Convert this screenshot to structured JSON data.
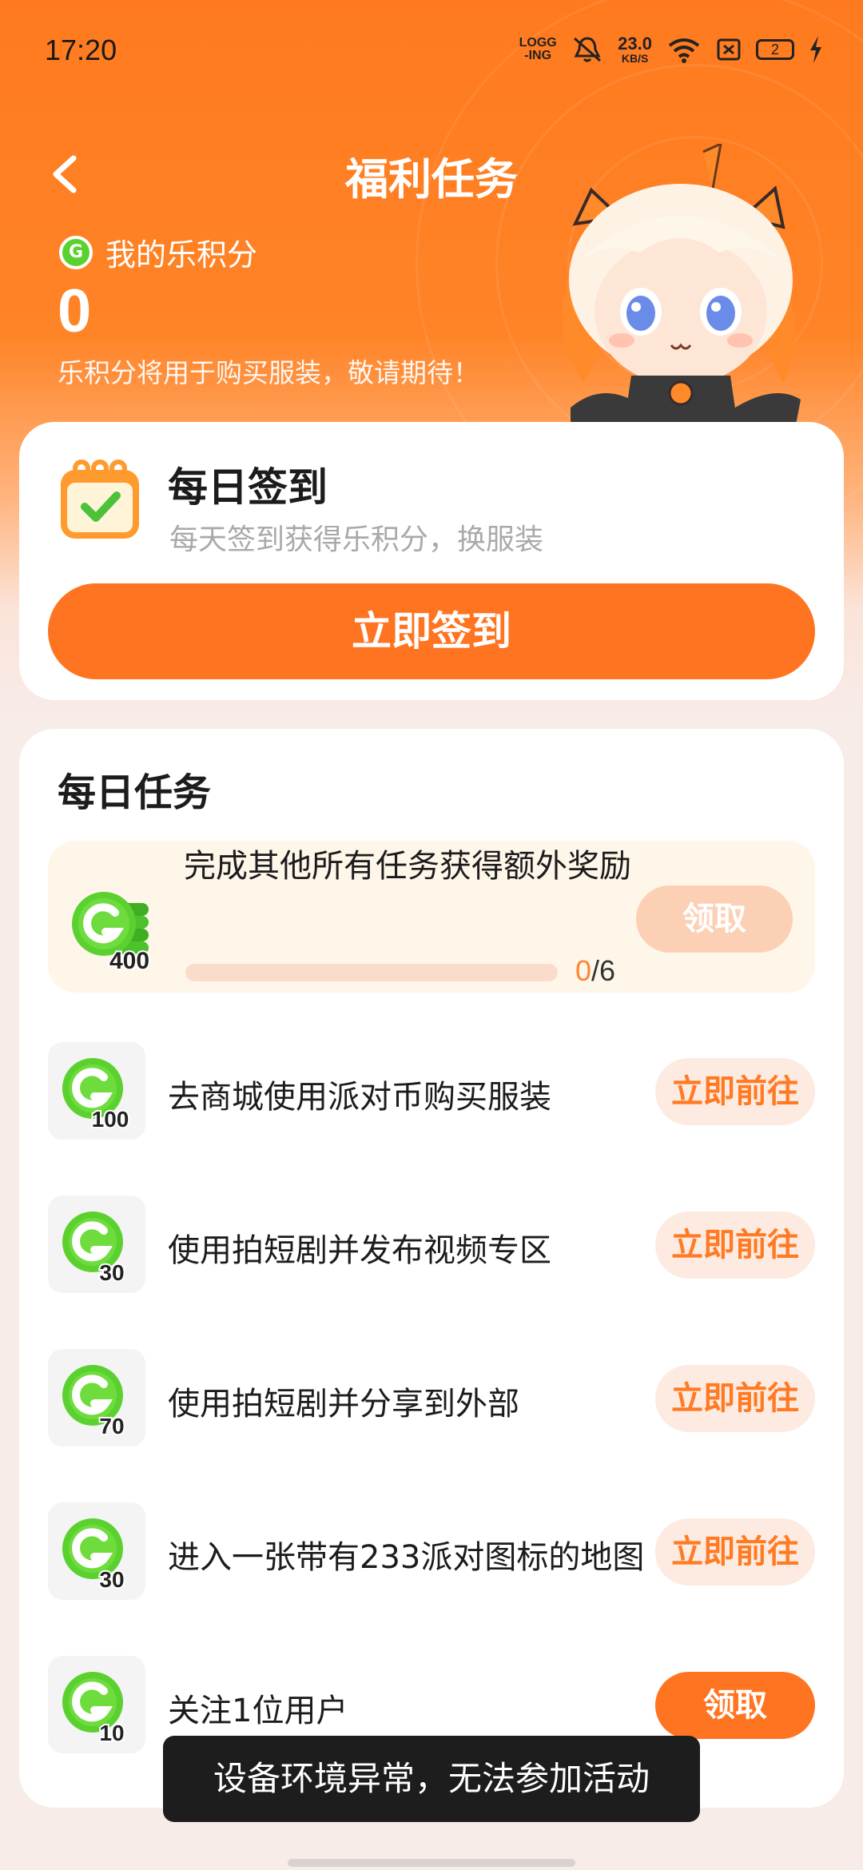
{
  "status_bar": {
    "time": "17:20",
    "logging": "LOGG -ING",
    "speed_value": "23.0",
    "speed_unit": "KB/S",
    "battery": "2"
  },
  "header": {
    "title": "福利任务",
    "points_label": "我的乐积分",
    "points_value": "0",
    "points_note": "乐积分将用于购买服装，敬请期待！",
    "coin_letter": "G"
  },
  "signin": {
    "title": "每日签到",
    "subtitle": "每天签到获得乐积分，换服装",
    "button": "立即签到"
  },
  "daily_tasks": {
    "title": "每日任务",
    "bonus": {
      "reward": "400",
      "text": "完成其他所有任务获得额外奖励",
      "progress_current": "0",
      "progress_sep": "/",
      "progress_total": "6",
      "progress_fraction": 0,
      "button": "领取"
    },
    "items": [
      {
        "reward": "100",
        "label": "去商城使用派对币购买服装",
        "button": "立即前往"
      },
      {
        "reward": "30",
        "label": "使用拍短剧并发布视频专区",
        "button": "立即前往"
      },
      {
        "reward": "70",
        "label": "使用拍短剧并分享到外部",
        "button": "立即前往"
      },
      {
        "reward": "30",
        "label": "进入一张带有233派对图标的地图",
        "button": "立即前往"
      },
      {
        "reward": "10",
        "label": "关注1位用户",
        "button": "领取"
      }
    ]
  },
  "toast": "设备环境异常，无法参加活动",
  "colors": {
    "accent": "#ff7420",
    "coin_green": "#5bd12f",
    "go_button_bg": "#fdeae0"
  }
}
